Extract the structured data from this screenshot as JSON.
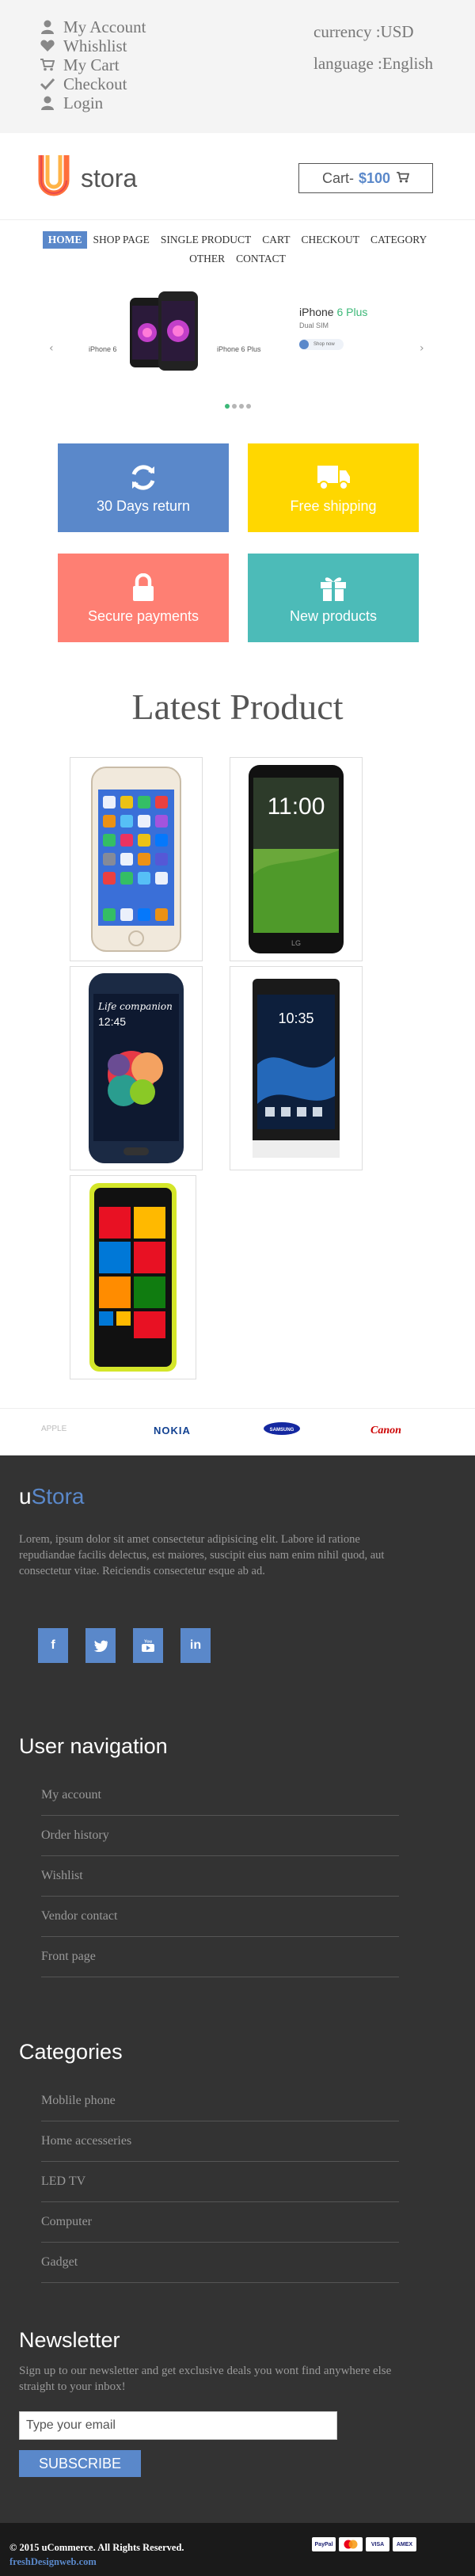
{
  "topbar": {
    "links": [
      {
        "label": "My Account",
        "icon": "user-icon"
      },
      {
        "label": "Whishlist",
        "icon": "heart-icon"
      },
      {
        "label": "My Cart",
        "icon": "cart-icon"
      },
      {
        "label": "Checkout",
        "icon": "check-icon"
      },
      {
        "label": "Login",
        "icon": "user-icon"
      }
    ],
    "currency": "currency :USD",
    "language": "language :English"
  },
  "header": {
    "logo_text": "stora",
    "cart_label": "Cart-",
    "cart_amount": "$100"
  },
  "nav": {
    "items": [
      "HOME",
      "SHOP PAGE",
      "SINGLE PRODUCT",
      "CART",
      "CHECKOUT",
      "CATEGORY",
      "OTHER",
      "CONTACT"
    ],
    "active": "HOME"
  },
  "slider": {
    "left_label": "iPhone 6",
    "mid_label": "iPhone 6 Plus",
    "title_prefix": "iPhone ",
    "title_highlight": "6 Plus",
    "subtitle": "Dual SIM",
    "shop_label": "Shop now",
    "dots": 4,
    "active_dot": 0
  },
  "promos": [
    {
      "label": "30 Days return",
      "icon": "refresh-icon",
      "color": "#5a88ca"
    },
    {
      "label": "Free shipping",
      "icon": "truck-icon",
      "color": "#ffd700"
    },
    {
      "label": "Secure payments",
      "icon": "lock-icon",
      "color": "#fe7f73"
    },
    {
      "label": "New products",
      "icon": "gift-icon",
      "color": "#4cbbb8"
    }
  ],
  "latest": {
    "title": "Latest Product",
    "phone_screen_text": {
      "lg_time": "11:00",
      "samsung_caption": "Life companion",
      "samsung_time": "12:45",
      "sony_time": "10:35"
    }
  },
  "brands": {
    "apple": "APPLE",
    "nokia": "NOKIA",
    "samsung": "SAMSUNG",
    "canon": "Canon"
  },
  "footer": {
    "logo_u": "u",
    "logo_rest": "Stora",
    "about": "Lorem, ipsum dolor sit amet consectetur adipisicing elit. Labore id ratione repudiandae facilis delectus, est maiores, suscipit eius nam enim nihil quod, aut consectetur vitae. Reiciendis consectetur esque ab ad.",
    "socials": [
      "f",
      "t",
      "▶",
      "in"
    ],
    "user_nav_title": "User navigation",
    "user_nav": [
      "My account",
      "Order history",
      "Wishlist",
      "Vendor contact",
      "Front page"
    ],
    "categories_title": "Categories",
    "categories": [
      "Moblile phone",
      "Home accesseries",
      "LED TV",
      "Computer",
      "Gadget"
    ],
    "newsletter_title": "Newsletter",
    "newsletter_text": "Sign up to our newsletter and get exclusive deals you wont find anywhere else straight to your inbox!",
    "email_placeholder": "Type your email",
    "subscribe_label": "SUBSCRIBE"
  },
  "bottom": {
    "copyright": "© 2015 uCommerce. All Rights Reserved.",
    "credit": "freshDesignweb.com",
    "cards": [
      "PayPal",
      "MC",
      "VISA",
      "AMEX"
    ]
  },
  "colors": {
    "accent": "#5a88ca",
    "green": "#3cb878",
    "yellow": "#ffd700",
    "salmon": "#fe7f73",
    "teal": "#4cbbb8",
    "footer_bg": "#333333"
  }
}
